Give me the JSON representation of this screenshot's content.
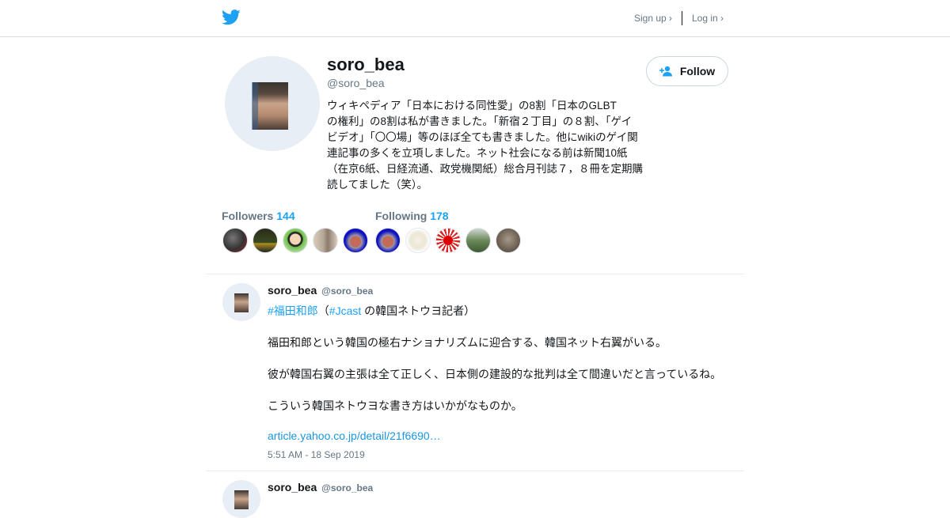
{
  "header": {
    "logo_icon": "twitter-bird-icon",
    "signup_label": "Sign up ›",
    "login_label": "Log in ›"
  },
  "profile": {
    "name": "soro_bea",
    "handle": "@soro_bea",
    "bio": "ウィキペディア「日本における同性愛」の8割「日本のGLBT\nの権利」の8割は私が書きました。「新宿２丁目」の８割、「ゲイ\nビデオ」「〇〇場」等のほぼ全ても書きました。他にwikiのゲイ関\n連記事の多くを立項しました。ネット社会になる前は新聞10紙\n（在京6紙、日経流通、政党機関紙）総合月刊誌７，８冊を定期購\n読してました（笑）。",
    "follow_label": "Follow"
  },
  "stats": {
    "followers_label": "Followers",
    "followers_count": "144",
    "following_label": "Following",
    "following_count": "178"
  },
  "tweets": [
    {
      "name": "soro_bea",
      "handle": "@soro_bea",
      "hashtag1": "#福田和郎",
      "paren_open": "（",
      "hashtag2": "#Jcast",
      "line1_rest": " の韓国ネトウヨ記者）",
      "line2": "福田和郎という韓国の極右ナショナリズムに迎合する、韓国ネット右翼がいる。",
      "line3": "彼が韓国右翼の主張は全て正しく、日本側の建設的な批判は全て間違いだと言っているね。",
      "line4": "こういう韓国ネトウヨな書き方はいかがなものか。",
      "link": "article.yahoo.co.jp/detail/21f6690…",
      "time": "5:51 AM - 18 Sep 2019"
    },
    {
      "name": "soro_bea",
      "handle": "@soro_bea"
    }
  ],
  "colors": {
    "accent": "#1da1f2",
    "link": "#1b95e0",
    "muted": "#657786"
  }
}
